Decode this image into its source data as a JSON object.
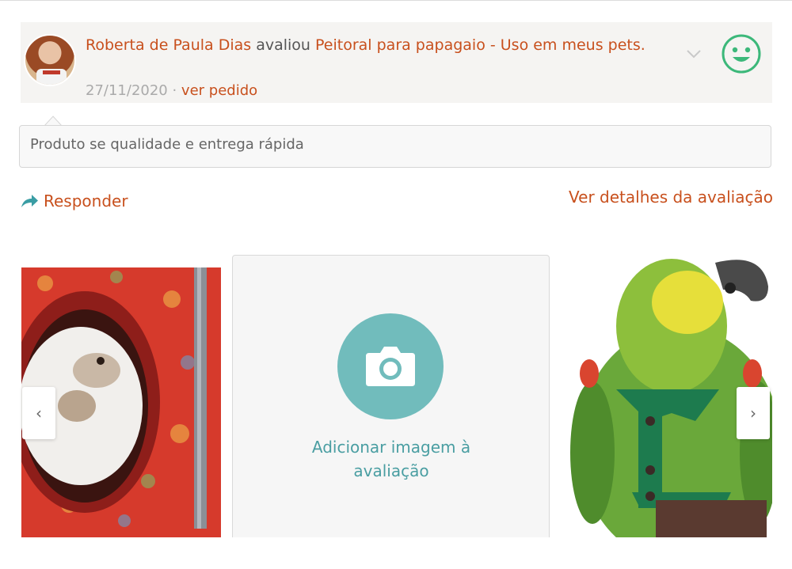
{
  "review": {
    "reviewer_name": "Roberta de Paula Dias",
    "action_word": " avaliou ",
    "product_title": "Peitoral para papagaio - Uso em meus pets.",
    "date": "27/11/2020",
    "separator": " · ",
    "order_link": "ver pedido",
    "sentiment_icon": "happy-face-icon",
    "comment": "Produto se qualidade e entrega rápida"
  },
  "actions": {
    "reply_label": "Responder",
    "details_label": "Ver detalhes da avaliação"
  },
  "gallery": {
    "add_image_label_line1": "Adicionar imagem à",
    "add_image_label_line2": "avaliação",
    "prev_label": "‹",
    "next_label": "›"
  },
  "colors": {
    "accent_orange": "#c8501d",
    "teal": "#71bcbc",
    "positive_green": "#3cb87a"
  }
}
